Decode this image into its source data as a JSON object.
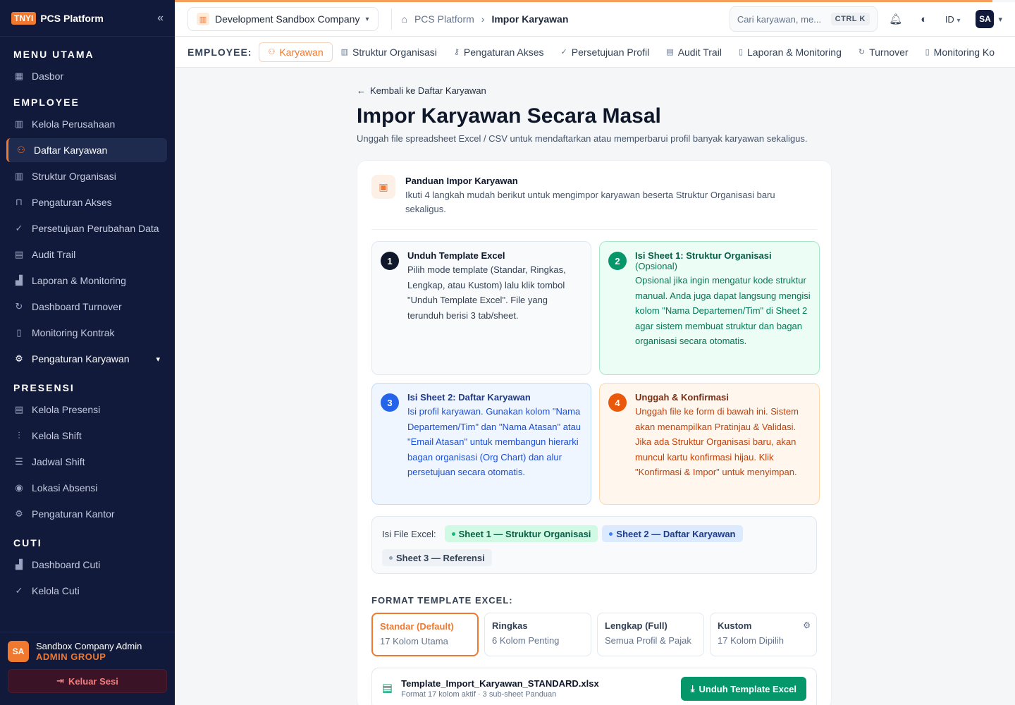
{
  "brand": {
    "badge": "TNYI",
    "name": "PCS Platform"
  },
  "sidebar": {
    "sections": [
      {
        "title": "MENU UTAMA",
        "items": [
          {
            "label": "Dasbor",
            "icon": "grid-icon"
          }
        ]
      },
      {
        "title": "EMPLOYEE",
        "items": [
          {
            "label": "Kelola Perusahaan",
            "icon": "building-icon"
          },
          {
            "label": "Daftar Karyawan",
            "icon": "users-icon",
            "active": true
          },
          {
            "label": "Struktur Organisasi",
            "icon": "building-icon"
          },
          {
            "label": "Pengaturan Akses",
            "icon": "lock-icon"
          },
          {
            "label": "Persetujuan Perubahan Data",
            "icon": "check-circle-icon"
          },
          {
            "label": "Audit Trail",
            "icon": "clipboard-icon"
          },
          {
            "label": "Laporan & Monitoring",
            "icon": "bar-chart-icon"
          },
          {
            "label": "Dashboard Turnover",
            "icon": "refresh-icon"
          },
          {
            "label": "Monitoring Kontrak",
            "icon": "file-icon"
          },
          {
            "label": "Pengaturan Karyawan",
            "icon": "gear-icon",
            "bold": true,
            "expandable": true
          }
        ]
      },
      {
        "title": "PRESENSI",
        "items": [
          {
            "label": "Kelola Presensi",
            "icon": "clipboard-icon"
          },
          {
            "label": "Kelola Shift",
            "icon": "sliders-icon"
          },
          {
            "label": "Jadwal Shift",
            "icon": "table-icon"
          },
          {
            "label": "Lokasi Absensi",
            "icon": "pin-icon"
          },
          {
            "label": "Pengaturan Kantor",
            "icon": "gear-icon"
          }
        ]
      },
      {
        "title": "CUTI",
        "items": [
          {
            "label": "Dashboard Cuti",
            "icon": "bar-chart-icon"
          },
          {
            "label": "Kelola Cuti",
            "icon": "check-circle-icon"
          }
        ]
      }
    ],
    "user": {
      "initials": "SA",
      "name": "Sandbox Company Admin",
      "role": "ADMIN GROUP"
    },
    "logout": "Keluar Sesi"
  },
  "header": {
    "company": "Development Sandbox Company",
    "breadcrumb": [
      "PCS Platform",
      "Impor Karyawan"
    ],
    "search_placeholder": "Cari karyawan, me...",
    "shortcut": "CTRL K",
    "lang": "ID",
    "avatar": "SA"
  },
  "tabs": {
    "label": "EMPLOYEE:",
    "items": [
      {
        "label": "Karyawan",
        "icon": "users-icon",
        "active": true
      },
      {
        "label": "Struktur Organisasi",
        "icon": "building-icon"
      },
      {
        "label": "Pengaturan Akses",
        "icon": "key-icon"
      },
      {
        "label": "Persetujuan Profil",
        "icon": "check-circle-icon"
      },
      {
        "label": "Audit Trail",
        "icon": "clipboard-icon"
      },
      {
        "label": "Laporan & Monitoring",
        "icon": "file-icon"
      },
      {
        "label": "Turnover",
        "icon": "refresh-icon"
      },
      {
        "label": "Monitoring Ko",
        "icon": "file-icon"
      }
    ]
  },
  "main": {
    "back": "Kembali ke Daftar Karyawan",
    "title": "Impor Karyawan Secara Masal",
    "subtitle": "Unggah file spreadsheet Excel / CSV untuk mendaftarkan atau memperbarui profil banyak karyawan sekaligus.",
    "guide": {
      "title": "Panduan Impor Karyawan",
      "desc": "Ikuti 4 langkah mudah berikut untuk mengimpor karyawan beserta Struktur Organisasi baru sekaligus."
    },
    "steps": [
      {
        "num": "1",
        "title": "Unduh Template Excel",
        "optional": "",
        "desc": "Pilih mode template (Standar, Ringkas, Lengkap, atau Kustom) lalu klik tombol \"Unduh Template Excel\". File yang terunduh berisi 3 tab/sheet."
      },
      {
        "num": "2",
        "title": "Isi Sheet 1: Struktur Organisasi",
        "optional": "(Opsional)",
        "desc": "Opsional jika ingin mengatur kode struktur manual. Anda juga dapat langsung mengisi kolom \"Nama Departemen/Tim\" di Sheet 2 agar sistem membuat struktur dan bagan organisasi secara otomatis."
      },
      {
        "num": "3",
        "title": "Isi Sheet 2: Daftar Karyawan",
        "optional": "",
        "desc": "Isi profil karyawan. Gunakan kolom \"Nama Departemen/Tim\" dan \"Nama Atasan\" atau \"Email Atasan\" untuk membangun hierarki bagan organisasi (Org Chart) dan alur persetujuan secara otomatis."
      },
      {
        "num": "4",
        "title": "Unggah & Konfirmasi",
        "optional": "",
        "desc": "Unggah file ke form di bawah ini. Sistem akan menampilkan Pratinjau & Validasi. Jika ada Struktur Organisasi baru, akan muncul kartu konfirmasi hijau. Klik \"Konfirmasi & Impor\" untuk menyimpan."
      }
    ],
    "file_contents": {
      "label": "Isi File Excel:",
      "sheets": [
        "Sheet 1 — Struktur Organisasi",
        "Sheet 2 — Daftar Karyawan",
        "Sheet 3 — Referensi"
      ]
    },
    "format_title": "FORMAT TEMPLATE EXCEL:",
    "formats": [
      {
        "name": "Standar (Default)",
        "desc": "17 Kolom Utama",
        "active": true
      },
      {
        "name": "Ringkas",
        "desc": "6 Kolom Penting"
      },
      {
        "name": "Lengkap (Full)",
        "desc": "Semua Profil & Pajak"
      },
      {
        "name": "Kustom",
        "desc": "17 Kolom Dipilih"
      }
    ],
    "download": {
      "filename": "Template_Import_Karyawan_STANDARD.xlsx",
      "sub": "Format 17 kolom aktif · 3 sub-sheet Panduan",
      "button": "Unduh Template Excel"
    }
  }
}
